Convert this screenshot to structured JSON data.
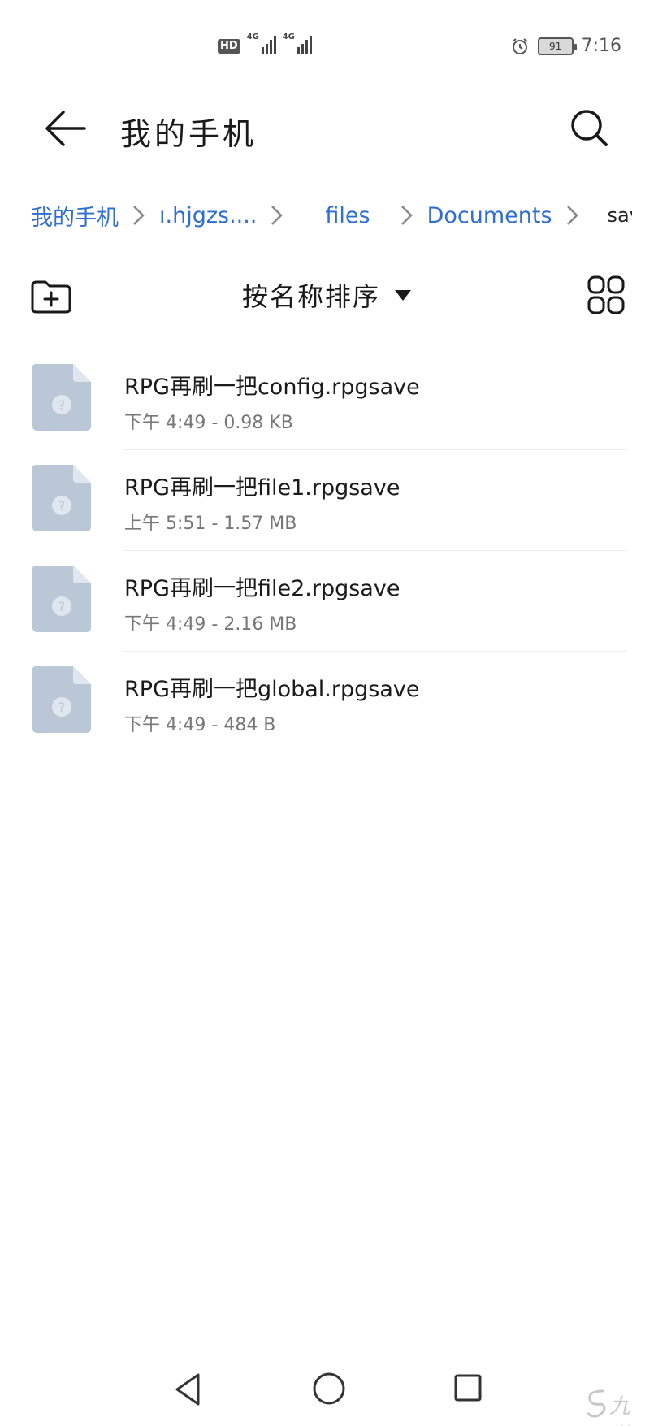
{
  "status_bar": {
    "hd": "HD",
    "network_1": "4G",
    "network_2": "4G",
    "battery": "91",
    "time": "7:16",
    "icons": [
      "hd-icon",
      "signal-icon",
      "signal-icon",
      "alarm-icon",
      "battery-icon"
    ]
  },
  "header": {
    "title": "我的手机",
    "back_icon": "arrow-left-icon",
    "search_icon": "search-icon"
  },
  "breadcrumb": {
    "items": [
      {
        "label": "我的手机"
      },
      {
        "label": "ı.hjgzs...."
      },
      {
        "label": "files"
      },
      {
        "label": "Documents"
      },
      {
        "label": "save"
      }
    ]
  },
  "toolbar": {
    "sort_label": "按名称排序",
    "new_folder_icon": "folder-add-icon",
    "view_icon": "grid-view-icon"
  },
  "files": [
    {
      "name": "RPG再刷一把config.rpgsave",
      "meta": "下午 4:49 - 0.98 KB"
    },
    {
      "name": "RPG再刷一把file1.rpgsave",
      "meta": "上午 5:51 - 1.57 MB"
    },
    {
      "name": "RPG再刷一把file2.rpgsave",
      "meta": "下午 4:49 - 2.16 MB"
    },
    {
      "name": "RPG再刷一把global.rpgsave",
      "meta": "下午 4:49 - 484 B"
    }
  ],
  "nav_bar": {
    "icons": [
      "nav-back-icon",
      "nav-home-icon",
      "nav-recent-icon"
    ]
  },
  "watermark": {
    "text": "九游"
  }
}
